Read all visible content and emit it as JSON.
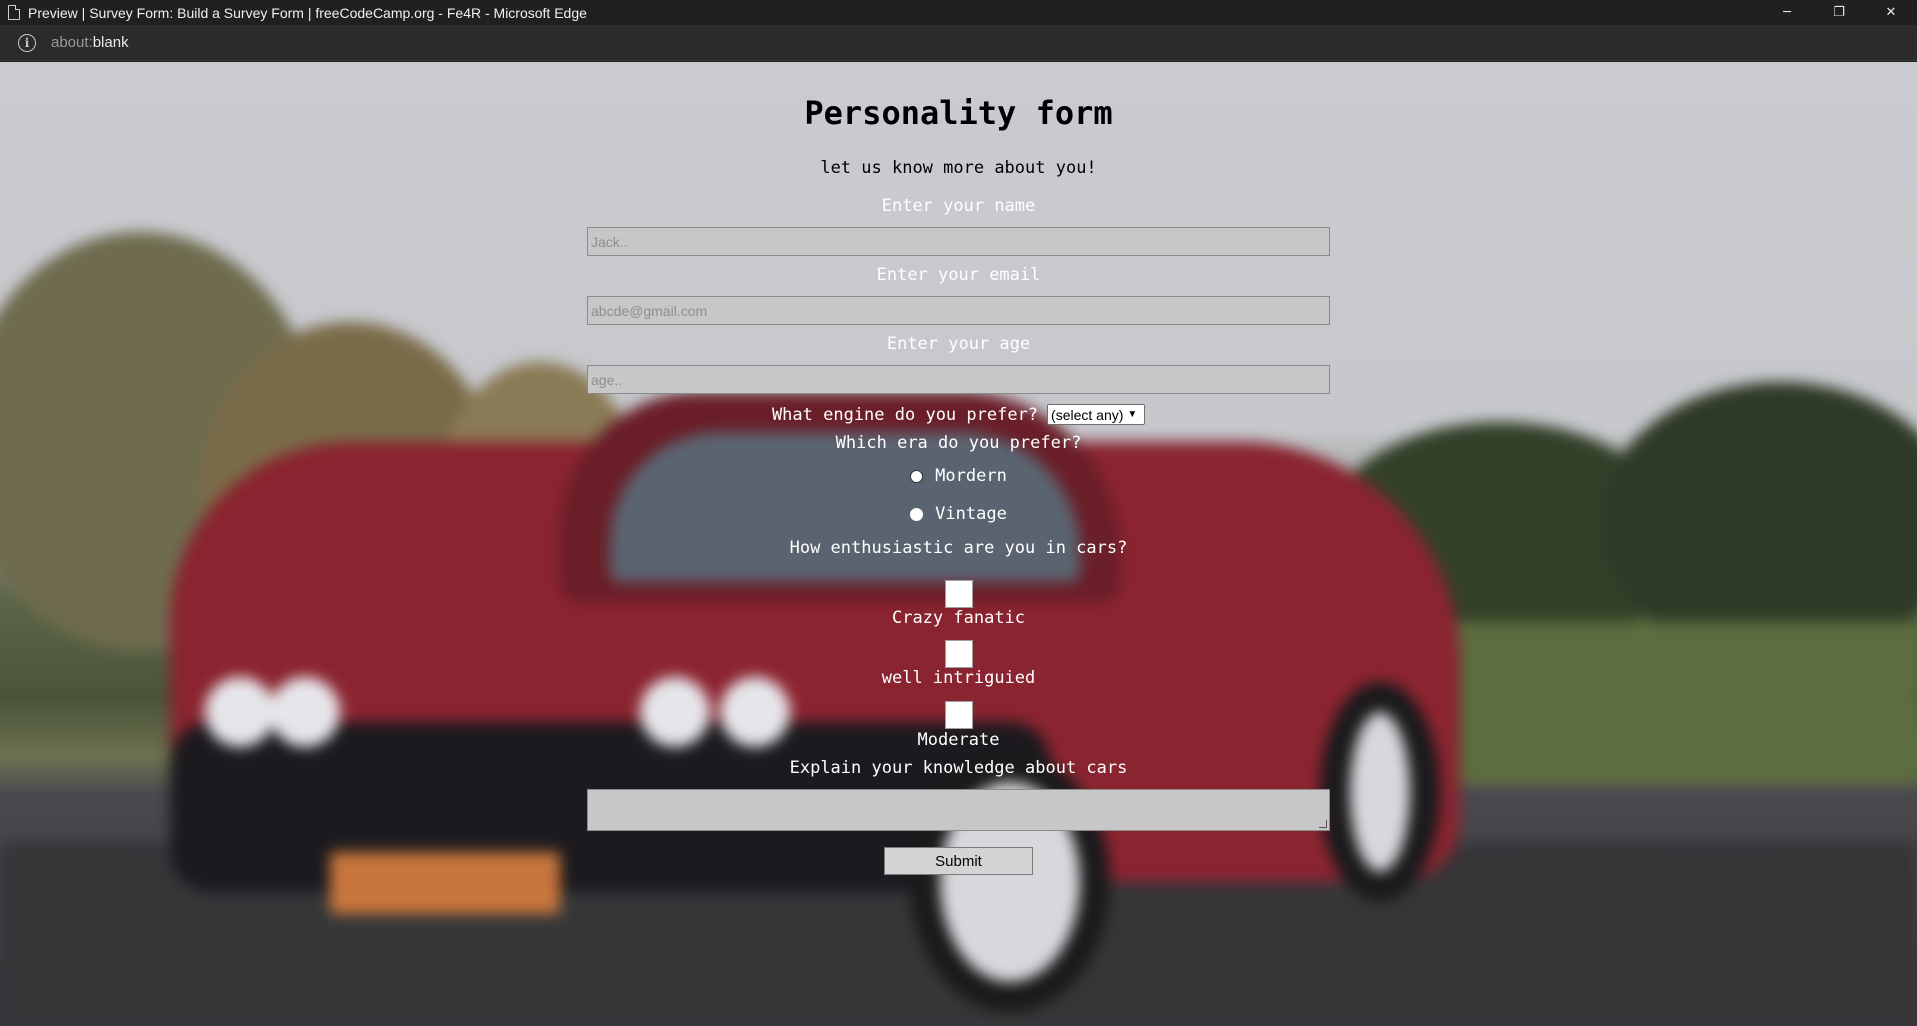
{
  "window": {
    "title": "Preview | Survey Form: Build a Survey Form | freeCodeCamp.org - Fe4R - Microsoft Edge",
    "minimize": "─",
    "restore": "❐",
    "close": "✕"
  },
  "address": {
    "scheme": "about:",
    "host": "blank"
  },
  "form": {
    "heading": "Personality form",
    "subtitle": "let us know more about you!",
    "name_label": "Enter your name",
    "name_placeholder": "Jack..",
    "email_label": "Enter your email",
    "email_placeholder": "abcde@gmail.com",
    "age_label": "Enter your age",
    "age_placeholder": "age..",
    "engine_label": "What engine do you prefer?",
    "engine_selected": "(select any)",
    "era_label": "Which era do you prefer?",
    "era_options": [
      "Mordern",
      "Vintage"
    ],
    "enthusiasm_label": "How enthusiastic are you in cars?",
    "enthusiasm_options": [
      "Crazy fanatic",
      "well intriguied",
      "Moderate"
    ],
    "knowledge_label": "Explain your knowledge about cars",
    "submit_label": "Submit"
  }
}
